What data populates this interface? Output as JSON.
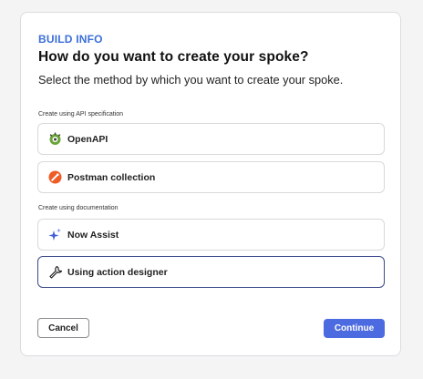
{
  "header": {
    "kicker": "BUILD INFO",
    "title": "How do you want to create your spoke?",
    "subtitle": "Select the method by which you want to create your spoke."
  },
  "sections": {
    "api": {
      "label": "Create using API specification",
      "options": [
        {
          "label": "OpenAPI",
          "icon": "openapi-icon"
        },
        {
          "label": "Postman collection",
          "icon": "postman-icon"
        }
      ]
    },
    "docs": {
      "label": "Create using documentation",
      "options": [
        {
          "label": "Now Assist",
          "icon": "sparkle-icon"
        },
        {
          "label": "Using action designer",
          "icon": "wrench-icon",
          "selected": true
        }
      ]
    }
  },
  "footer": {
    "cancel_label": "Cancel",
    "continue_label": "Continue"
  },
  "colors": {
    "accent": "#4d6be0",
    "kicker": "#3b6fd8",
    "postman": "#ef5b25",
    "openapi": "#6ba539",
    "selected_border": "#3b4a8c"
  }
}
